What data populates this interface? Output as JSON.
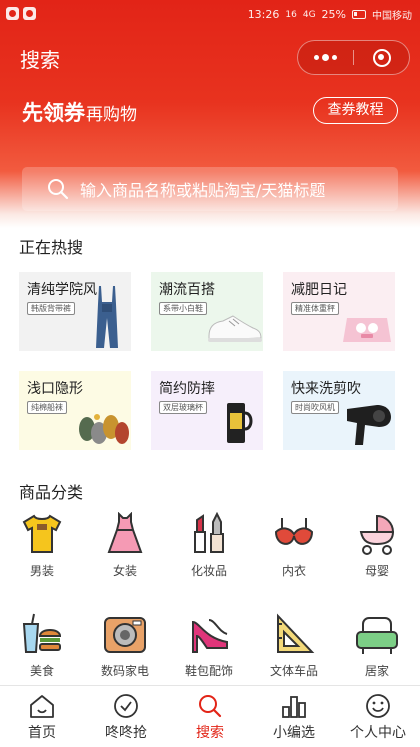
{
  "status_bar": {
    "time": "13:26",
    "net_speed": "16",
    "signal": "4G",
    "battery": "25%",
    "carrier": "中国移动"
  },
  "nav": {
    "title": "搜索"
  },
  "promo": {
    "bold": "先领券",
    "light": "再购物",
    "tutorial_label": "查券教程"
  },
  "search": {
    "placeholder": "输入商品名称或粘贴淘宝/天猫标题"
  },
  "hot": {
    "title": "正在热搜",
    "cards": [
      {
        "title": "清纯学院风",
        "tag": "韩版背带裤",
        "bg": "#f2f2f2",
        "icon": "overalls-icon"
      },
      {
        "title": "潮流百搭",
        "tag": "系带小白鞋",
        "bg": "#ecf7ec",
        "icon": "sneaker-icon"
      },
      {
        "title": "减肥日记",
        "tag": "精准体重秤",
        "bg": "#fbeef2",
        "icon": "scale-icon"
      },
      {
        "title": "浅口隐形",
        "tag": "纯棉船袜",
        "bg": "#fdfbe4",
        "icon": "socks-icon"
      },
      {
        "title": "简约防摔",
        "tag": "双层玻璃杯",
        "bg": "#f6effb",
        "icon": "glass-cup-icon"
      },
      {
        "title": "快来洗剪吹",
        "tag": "时尚吹风机",
        "bg": "#eaf4fb",
        "icon": "hairdryer-icon"
      }
    ]
  },
  "categories": {
    "title": "商品分类",
    "items": [
      {
        "label": "男装",
        "icon": "tshirt-icon"
      },
      {
        "label": "女装",
        "icon": "dress-icon"
      },
      {
        "label": "化妆品",
        "icon": "cosmetics-icon"
      },
      {
        "label": "内衣",
        "icon": "bra-icon"
      },
      {
        "label": "母婴",
        "icon": "stroller-icon"
      },
      {
        "label": "美食",
        "icon": "food-icon"
      },
      {
        "label": "数码家电",
        "icon": "camera-icon"
      },
      {
        "label": "鞋包配饰",
        "icon": "high-heel-icon"
      },
      {
        "label": "文体车品",
        "icon": "ruler-icon"
      },
      {
        "label": "居家",
        "icon": "sofa-icon"
      }
    ]
  },
  "tabbar": {
    "items": [
      {
        "label": "首页",
        "icon": "home-icon",
        "active": false
      },
      {
        "label": "咚咚抢",
        "icon": "clock-icon",
        "active": false
      },
      {
        "label": "搜索",
        "icon": "search-icon",
        "active": true
      },
      {
        "label": "小编选",
        "icon": "chart-icon",
        "active": false
      },
      {
        "label": "个人中心",
        "icon": "smiley-icon",
        "active": false
      }
    ],
    "active_color": "#e22417"
  },
  "colors": {
    "brand": "#e22417",
    "text": "#222222"
  }
}
